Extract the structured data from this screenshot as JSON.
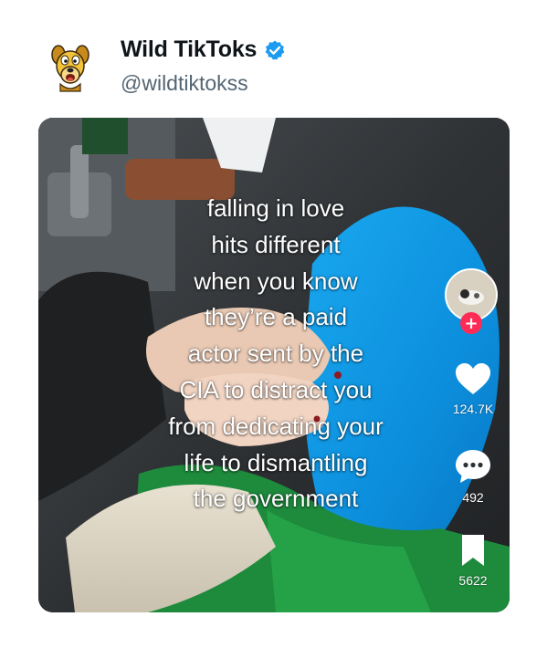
{
  "post": {
    "author_name": "Wild TikToks",
    "handle": "@wildtiktokss",
    "verified": true
  },
  "video": {
    "caption_lines": [
      "falling in love",
      "hits different",
      "when you know",
      "they’re a paid",
      "actor sent by the",
      "CIA to distract you",
      "from dedicating your",
      "life to dismantling",
      "the government"
    ],
    "actions": {
      "likes": "124.7K",
      "comments": "492",
      "bookmarks": "5622",
      "follow_label": "+"
    }
  },
  "icons": {
    "verified": "verified-badge-icon",
    "like": "heart-icon",
    "comment": "comment-bubble-icon",
    "bookmark": "bookmark-icon",
    "avatar": "cartoon-dog-avatar"
  },
  "colors": {
    "verified_blue": "#1d9bf0",
    "follow_red": "#fe2c55",
    "author_text": "#0f1419",
    "handle_text": "#536471"
  }
}
